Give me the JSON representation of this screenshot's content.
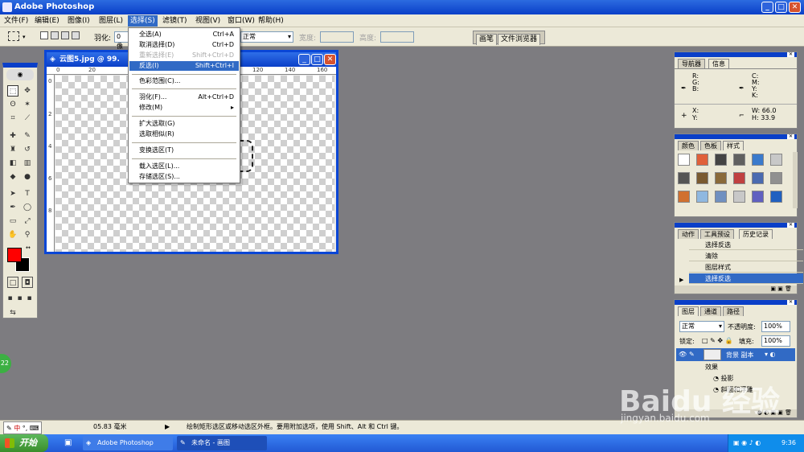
{
  "app_title": "Adobe Photoshop",
  "menubar": [
    "文件(F)",
    "编辑(E)",
    "图像(I)",
    "图层(L)",
    "选择(S)",
    "滤镜(T)",
    "视图(V)",
    "窗口(W)",
    "帮助(H)"
  ],
  "options": {
    "feather_label": "羽化:",
    "feather_value": "0 像",
    "style_value": "正常",
    "width_label": "宽度:",
    "height_label": "高度:",
    "palette_tabs": [
      "画笔",
      "文件浏览器"
    ]
  },
  "document": {
    "title": "云图5.jpg @ 99.",
    "ruler_top": [
      "0",
      "20",
      "120",
      "140",
      "160"
    ],
    "ruler_left": [
      "0",
      "2",
      "4",
      "6",
      "8"
    ]
  },
  "select_menu": [
    {
      "label": "全选(A)",
      "shortcut": "Ctrl+A",
      "state": "normal"
    },
    {
      "label": "取消选择(D)",
      "shortcut": "Ctrl+D",
      "state": "normal"
    },
    {
      "label": "重新选择(E)",
      "shortcut": "Shift+Ctrl+D",
      "state": "disabled"
    },
    {
      "label": "反选(I)",
      "shortcut": "Shift+Ctrl+I",
      "state": "highlight"
    },
    {
      "label": "色彩范围(C)...",
      "shortcut": "",
      "state": "normal"
    },
    {
      "label": "羽化(F)...",
      "shortcut": "Alt+Ctrl+D",
      "state": "normal"
    },
    {
      "label": "修改(M)",
      "shortcut": "▸",
      "state": "normal"
    },
    {
      "label": "扩大选取(G)",
      "shortcut": "",
      "state": "normal"
    },
    {
      "label": "选取相似(R)",
      "shortcut": "",
      "state": "normal"
    },
    {
      "label": "变换选区(T)",
      "shortcut": "",
      "state": "normal"
    },
    {
      "label": "载入选区(L)...",
      "shortcut": "",
      "state": "normal"
    },
    {
      "label": "存储选区(S)...",
      "shortcut": "",
      "state": "normal"
    }
  ],
  "nav_panel": {
    "tabs": [
      "导航器",
      "信息"
    ],
    "rgb": [
      "R:",
      "G:",
      "B:"
    ],
    "cmyk": [
      "C:",
      "M:",
      "Y:",
      "K:"
    ],
    "xy": [
      "X:",
      "Y:"
    ],
    "w_label": "W:",
    "w_value": "66.0",
    "h_label": "H:",
    "h_value": "33.9"
  },
  "color_panel": {
    "tabs": [
      "颜色",
      "色板",
      "样式"
    ],
    "swatches": [
      "#ffffff",
      "#e0603a",
      "#444444",
      "#606060",
      "#3a7acc",
      "#c8c8c8",
      "#555555",
      "#7a5a30",
      "#8a6a3a",
      "#c04040",
      "#4a6ab0",
      "#909090",
      "#d07030",
      "#90b8e0",
      "#7090c0",
      "#c8c8c8",
      "#6060c0",
      "#2060c0"
    ]
  },
  "history_panel": {
    "tabs": [
      "动作",
      "工具预设",
      "历史记录"
    ],
    "items": [
      "选择反选",
      "清除",
      "图层样式",
      "选择反选"
    ]
  },
  "layers_panel": {
    "tabs": [
      "图层",
      "通道",
      "路径"
    ],
    "blend": "正常",
    "opacity_label": "不透明度:",
    "opacity": "100%",
    "lock_label": "锁定:",
    "fill_label": "填充:",
    "fill": "100%",
    "layer_name": "背景 副本",
    "effects_label": "效果",
    "effect_1": "投影",
    "effect_2": "斜面和浮雕"
  },
  "statusbar": {
    "zoom": "05.83 毫米",
    "message": "绘制矩形选区或移动选区外框。要用附加选项，使用 Shift、Alt 和 Ctrl 键。"
  },
  "taskbar": {
    "start": "开始",
    "items": [
      "Adobe Photoshop",
      "未命名 - 画图"
    ],
    "time": "9:36"
  },
  "ime_label": "中",
  "badge_number": "22",
  "watermark": "Baidu 经验",
  "watermark_url": "jingyan.baidu.com"
}
